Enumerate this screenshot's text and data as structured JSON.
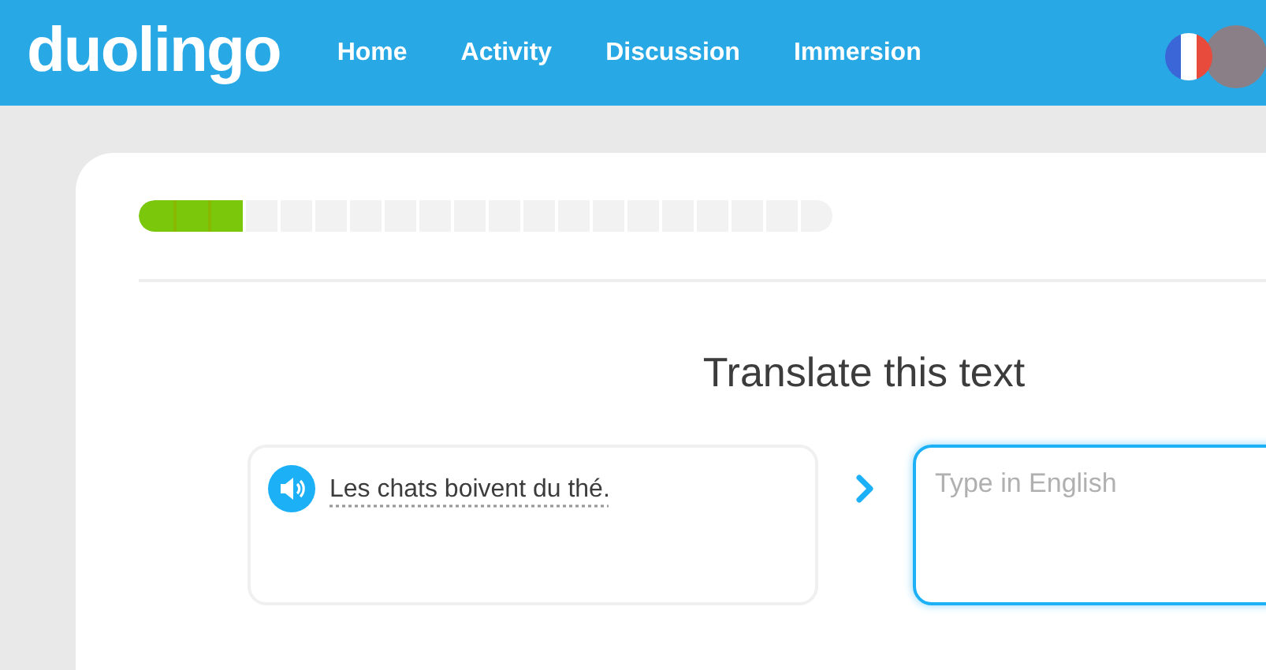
{
  "header": {
    "logo": "duolingo",
    "nav": [
      {
        "label": "Home"
      },
      {
        "label": "Activity"
      },
      {
        "label": "Discussion"
      },
      {
        "label": "Immersion"
      }
    ]
  },
  "lesson": {
    "progress": {
      "level": 0.15
    },
    "title": "Translate this text",
    "sentence": "Les chats boivent du thé.",
    "answer": {
      "placeholder": "Type in English"
    }
  }
}
